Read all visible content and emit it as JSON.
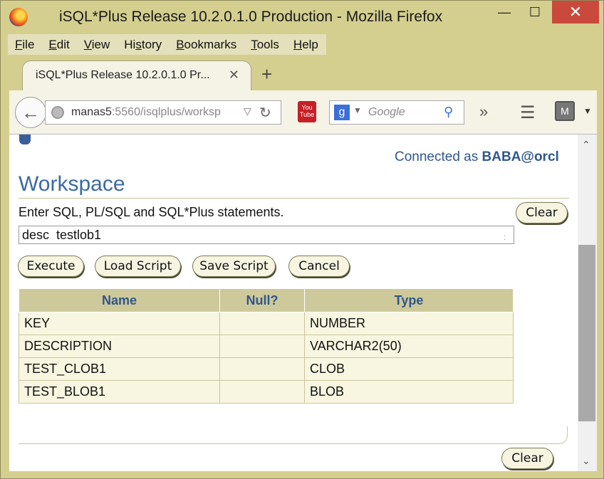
{
  "window": {
    "title": "iSQL*Plus Release 10.2.0.1.0 Production - Mozilla Firefox",
    "min_glyph": "—",
    "max_glyph": "☐",
    "close_glyph": "✕"
  },
  "menu": [
    {
      "label": "File",
      "key": "F",
      "rest": "ile"
    },
    {
      "label": "Edit",
      "key": "E",
      "rest": "dit"
    },
    {
      "label": "View",
      "key": "V",
      "rest": "iew"
    },
    {
      "label": "History",
      "key": "s",
      "pre": "Hi",
      "rest": "tory"
    },
    {
      "label": "Bookmarks",
      "key": "B",
      "rest": "ookmarks"
    },
    {
      "label": "Tools",
      "key": "T",
      "rest": "ools"
    },
    {
      "label": "Help",
      "key": "H",
      "rest": "elp"
    }
  ],
  "tab": {
    "label": "iSQL*Plus Release 10.2.0.1.0 Pr...",
    "close_glyph": "✕",
    "new_tab_glyph": "+"
  },
  "nav": {
    "url_host": "manas5",
    "url_rest": ":5560/isqlplus/worksp",
    "search_placeholder": "Google",
    "yt_label": "You Tube",
    "addon_label": "M"
  },
  "page": {
    "connected_prefix": "Connected as ",
    "connected_user": "BABA@orcl",
    "heading": "Workspace",
    "instructions": "Enter SQL, PL/SQL and SQL*Plus statements.",
    "sql_value": "desc  testlob1"
  },
  "buttons": {
    "clear_top": "Clear",
    "execute": "Execute",
    "load_script": "Load Script",
    "save_script": "Save Script",
    "cancel": "Cancel",
    "clear_bottom": "Clear"
  },
  "table": {
    "headers": [
      "Name",
      "Null?",
      "Type"
    ],
    "rows": [
      [
        "KEY",
        "",
        "NUMBER"
      ],
      [
        "DESCRIPTION",
        "",
        "VARCHAR2(50)"
      ],
      [
        "TEST_CLOB1",
        "",
        "CLOB"
      ],
      [
        "TEST_BLOB1",
        "",
        "BLOB"
      ]
    ]
  },
  "colors": {
    "accent_blue": "#30578b",
    "header_bg": "#cdc99a",
    "row_bg": "#f8f6e1",
    "close_red": "#c94a3c"
  }
}
